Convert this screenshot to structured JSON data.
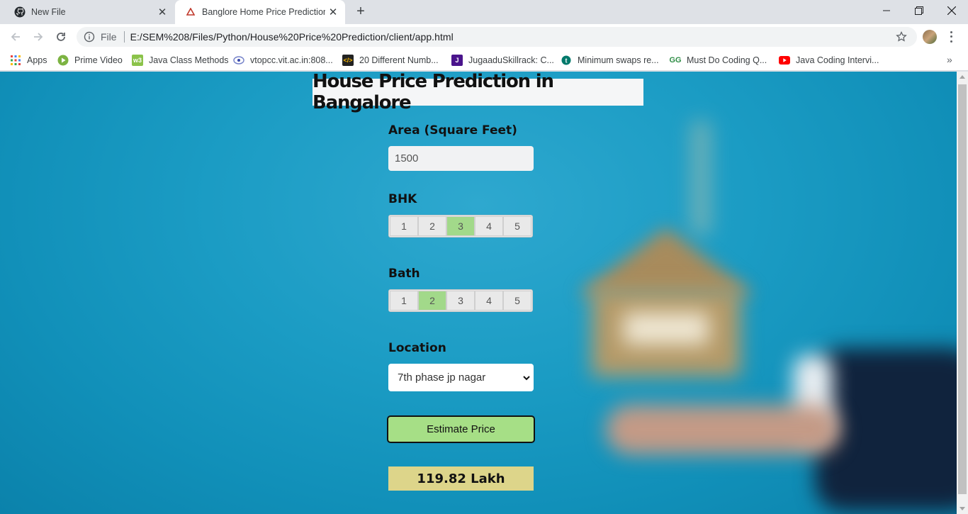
{
  "browser": {
    "tabs": [
      {
        "title": "New File",
        "icon": "github-icon"
      },
      {
        "title": "Banglore Home Price Prediction",
        "icon": "page-favicon"
      }
    ],
    "address": {
      "scheme": "File",
      "url": "E:/SEM%208/Files/Python/House%20Price%20Prediction/client/app.html"
    },
    "bookmarks": [
      {
        "label": "Apps",
        "icon": "apps-grid-icon"
      },
      {
        "label": "Prime Video",
        "icon": "prime-video-icon"
      },
      {
        "label": "Java Class Methods",
        "icon": "w3-icon"
      },
      {
        "label": "vtopcc.vit.ac.in:808...",
        "icon": "vit-icon"
      },
      {
        "label": "20 Different Numb...",
        "icon": "code-icon"
      },
      {
        "label": "JugaaduSkillrack: C...",
        "icon": "jugaadu-icon"
      },
      {
        "label": "Minimum swaps re...",
        "icon": "tutorialcup-icon"
      },
      {
        "label": "Must Do Coding Q...",
        "icon": "geeksforgeeks-icon"
      },
      {
        "label": "Java Coding Intervi...",
        "icon": "youtube-icon"
      }
    ],
    "more_symbol": "»"
  },
  "app": {
    "title": "House Price Prediction in Bangalore",
    "area": {
      "label": "Area (Square Feet)",
      "value": "1500"
    },
    "bhk": {
      "label": "BHK",
      "options": [
        "1",
        "2",
        "3",
        "4",
        "5"
      ],
      "selected": "3"
    },
    "bath": {
      "label": "Bath",
      "options": [
        "1",
        "2",
        "3",
        "4",
        "5"
      ],
      "selected": "2"
    },
    "location": {
      "label": "Location",
      "selected": "7th phase jp nagar"
    },
    "estimate_button": "Estimate Price",
    "result": "119.82 Lakh"
  },
  "colors": {
    "selected_option": "#a2d98a",
    "button": "#a6df86",
    "result_bg": "#ddd58a",
    "page_bg": "#1b9cc4"
  }
}
